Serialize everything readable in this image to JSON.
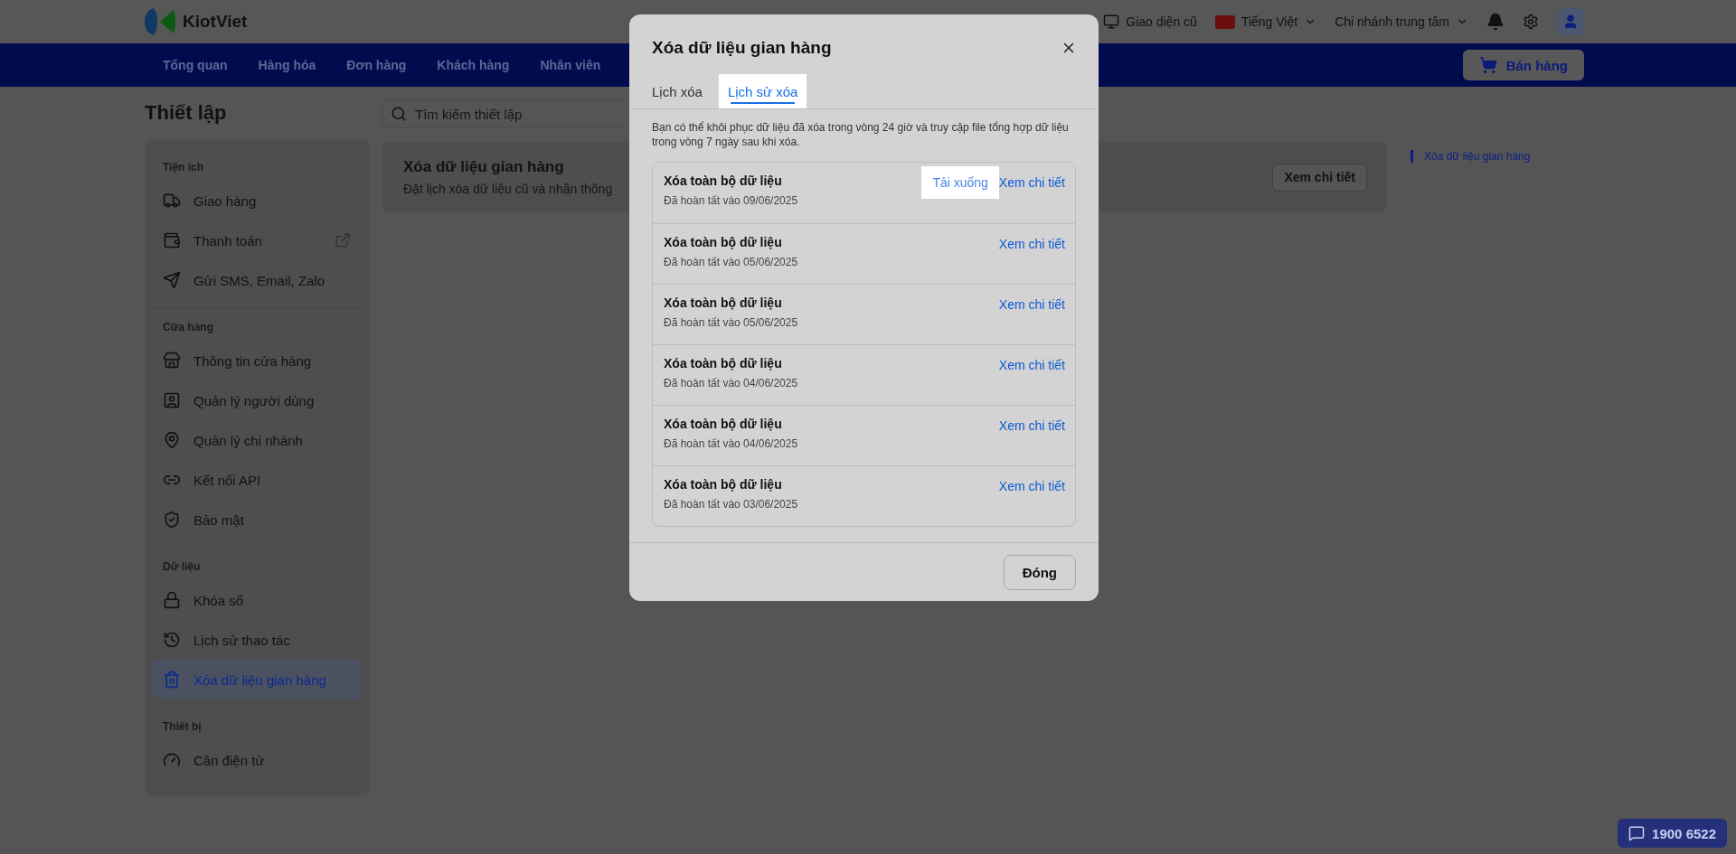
{
  "header": {
    "logo_text": "KiotViet",
    "links": [
      {
        "kind": "legacy",
        "label": "Giao diện cũ"
      },
      {
        "kind": "language",
        "label": "Tiếng Việt"
      },
      {
        "kind": "branch",
        "label": "Chi nhánh trung tâm"
      }
    ]
  },
  "nav": {
    "items": [
      {
        "label": "Tổng quan",
        "selected": false
      },
      {
        "label": "Hàng hóa",
        "selected": false
      },
      {
        "label": "Đơn hàng",
        "selected": false
      },
      {
        "label": "Khách hàng",
        "selected": false
      },
      {
        "label": "Nhân viên",
        "selected": false
      }
    ],
    "sell_button": "Bán hàng"
  },
  "page": {
    "title": "Thiết lập",
    "search": {
      "placeholder": "Tìm kiếm thiết lập"
    },
    "sidebar": [
      {
        "title": "Tiện ích",
        "items": [
          {
            "label": "Giao hàng",
            "selected": false,
            "external": false
          },
          {
            "label": "Thanh toán",
            "selected": false,
            "external": true
          },
          {
            "label": "Gửi SMS, Email, Zalo",
            "selected": false,
            "external": false
          }
        ]
      },
      {
        "title": "Cửa hàng",
        "items": [
          {
            "label": "Thông tin cửa hàng",
            "selected": false,
            "external": false
          },
          {
            "label": "Quản lý người dùng",
            "selected": false,
            "external": false
          },
          {
            "label": "Quản lý chi nhánh",
            "selected": false,
            "external": false
          },
          {
            "label": "Kết nối API",
            "selected": false,
            "external": false
          },
          {
            "label": "Bảo mật",
            "selected": false,
            "external": false
          }
        ]
      },
      {
        "title": "Dữ liệu",
        "items": [
          {
            "label": "Khóa sổ",
            "selected": false,
            "external": false
          },
          {
            "label": "Lịch sử thao tác",
            "selected": false,
            "external": false
          },
          {
            "label": "Xóa dữ liệu gian hàng",
            "selected": true,
            "external": false
          }
        ]
      },
      {
        "title": "Thiết bị",
        "items": [
          {
            "label": "Cân điện tử",
            "selected": false,
            "external": false
          }
        ]
      }
    ],
    "card": {
      "title": "Xóa dữ liệu gian hàng",
      "description": "Đặt lịch xóa dữ liệu cũ và nhận thông",
      "button": "Xem chi tiết"
    },
    "outline": [
      {
        "label": "Xóa dữ liệu gian hàng",
        "selected": true
      }
    ]
  },
  "modal": {
    "title": "Xóa dữ liệu gian hàng",
    "tabs": [
      {
        "label": "Lịch xóa",
        "selected": false,
        "highlighted": false
      },
      {
        "label": "Lịch sử xóa",
        "selected": true,
        "highlighted": true
      }
    ],
    "notice": "Bạn có thể khôi phục dữ liệu đã xóa trong vòng 24 giờ và truy cập file tổng hợp dữ liệu trong vòng 7 ngày sau khi xóa.",
    "records": [
      {
        "title": "Xóa toàn bộ dữ liệu",
        "date": "Đã hoàn tất vào 09/06/2025",
        "download": "Tải xuống",
        "download_highlighted": true,
        "detail_link": "Xem chi tiết"
      },
      {
        "title": "Xóa toàn bộ dữ liệu",
        "date": "Đã hoàn tất vào 05/06/2025",
        "detail_link": "Xem chi tiết"
      },
      {
        "title": "Xóa toàn bộ dữ liệu",
        "date": "Đã hoàn tất vào 05/06/2025",
        "detail_link": "Xem chi tiết"
      },
      {
        "title": "Xóa toàn bộ dữ liệu",
        "date": "Đã hoàn tất vào 04/06/2025",
        "detail_link": "Xem chi tiết"
      },
      {
        "title": "Xóa toàn bộ dữ liệu",
        "date": "Đã hoàn tất vào 04/06/2025",
        "detail_link": "Xem chi tiết"
      },
      {
        "title": "Xóa toàn bộ dữ liệu",
        "date": "Đã hoàn tất vào 03/06/2025",
        "detail_link": "Xem chi tiết"
      }
    ],
    "close_button": "Đóng"
  },
  "hotline": "1900 6522"
}
